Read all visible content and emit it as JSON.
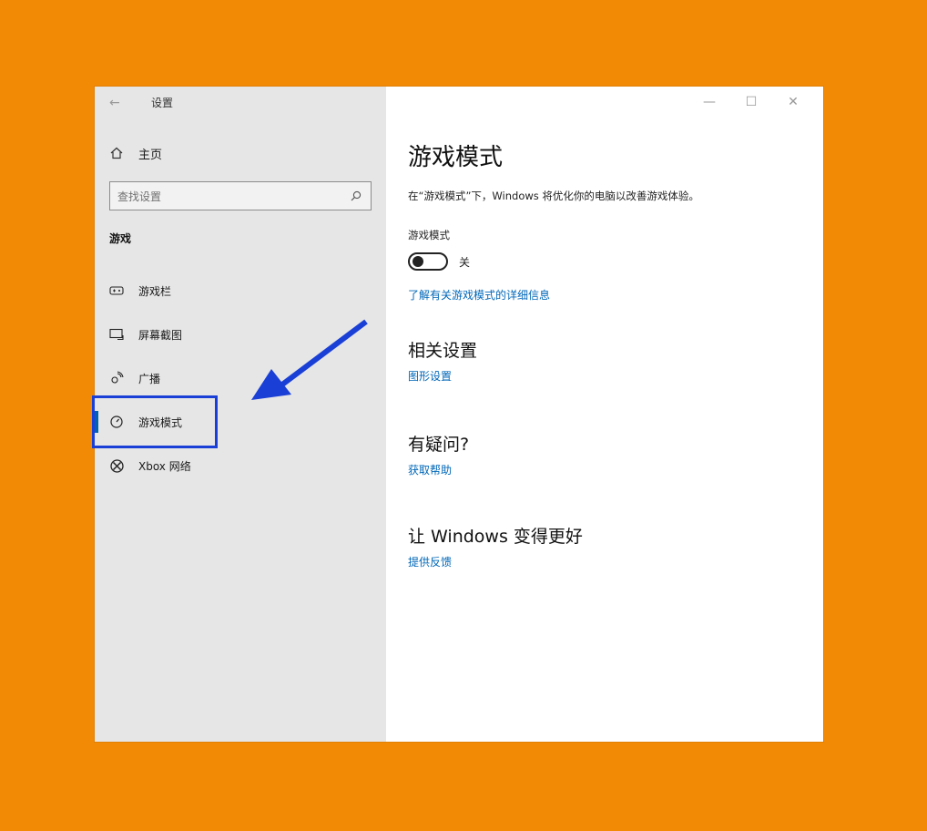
{
  "window": {
    "title": "设置",
    "controls": {
      "minimize": "—",
      "maximize": "☐",
      "close": "✕"
    }
  },
  "sidebar": {
    "home_label": "主页",
    "search_placeholder": "查找设置",
    "section_title": "游戏",
    "items": [
      {
        "label": "游戏栏",
        "icon": "game-bar-icon"
      },
      {
        "label": "屏幕截图",
        "icon": "screenshot-icon"
      },
      {
        "label": "广播",
        "icon": "broadcast-icon"
      },
      {
        "label": "游戏模式",
        "icon": "game-mode-icon",
        "active": true
      },
      {
        "label": "Xbox 网络",
        "icon": "xbox-icon"
      }
    ]
  },
  "content": {
    "title": "游戏模式",
    "description": "在“游戏模式”下，Windows 将优化你的电脑以改善游戏体验。",
    "toggle_label": "游戏模式",
    "toggle_state": "关",
    "learn_more_link": "了解有关游戏模式的详细信息",
    "related_heading": "相关设置",
    "related_link": "图形设置",
    "question_heading": "有疑问?",
    "help_link": "获取帮助",
    "feedback_heading": "让 Windows 变得更好",
    "feedback_link": "提供反馈"
  },
  "colors": {
    "background": "#f38a06",
    "accent": "#0067b8",
    "highlight_box": "#1a3fd6",
    "arrow": "#1a3fd6"
  }
}
